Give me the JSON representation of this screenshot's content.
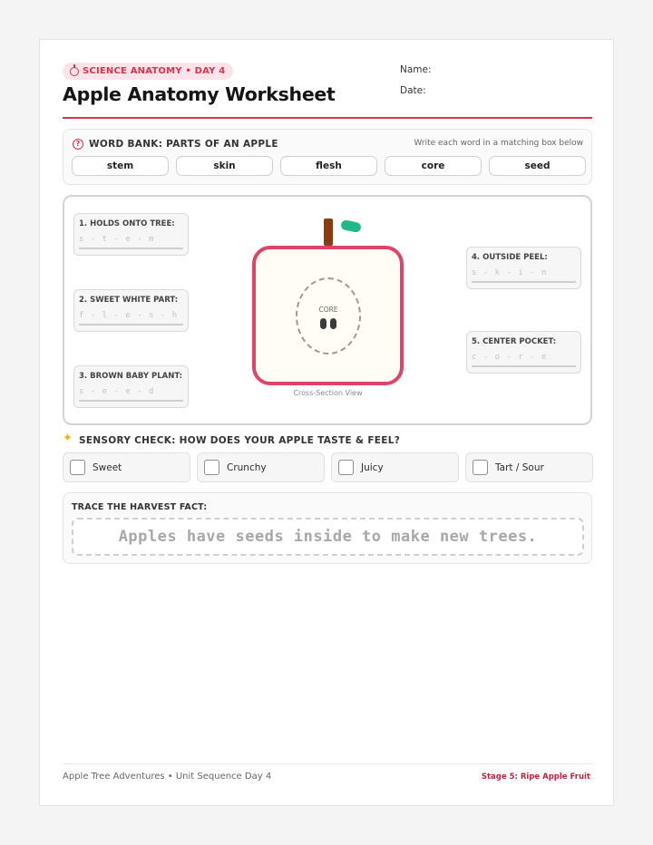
{
  "header": {
    "badge_text": "SCIENCE ANATOMY • DAY 4",
    "badge_icon": "apple-icon",
    "title": "Apple Anatomy Worksheet",
    "name_label": "Name:",
    "date_label": "Date:"
  },
  "word_bank": {
    "heading": "WORD BANK: PARTS OF AN APPLE",
    "hint": "Write each word in a matching box below",
    "words": [
      "stem",
      "skin",
      "flesh",
      "core",
      "seed"
    ]
  },
  "diagram": {
    "labels": [
      {
        "text": "1. HOLDS ONTO TREE:",
        "trace": "s - t - e - m"
      },
      {
        "text": "2. SWEET WHITE PART:",
        "trace": "f - l - e - s - h"
      },
      {
        "text": "3. BROWN BABY PLANT:",
        "trace": "s - e - e - d"
      },
      {
        "text": "4. OUTSIDE PEEL:",
        "trace": "s - k - i - n"
      },
      {
        "text": "5. CENTER POCKET:",
        "trace": "c - o - r - e"
      }
    ],
    "core_label": "CORE",
    "caption": "Cross-Section View"
  },
  "sensory": {
    "heading": "SENSORY CHECK: HOW DOES YOUR APPLE TASTE & FEEL?",
    "options": [
      "Sweet",
      "Crunchy",
      "Juicy",
      "Tart / Sour"
    ]
  },
  "trace_fact": {
    "heading": "TRACE THE HARVEST FACT:",
    "text": "Apples have seeds inside to make new trees."
  },
  "footer": {
    "left": "Apple Tree Adventures • Unit Sequence Day 4",
    "right": "Stage 5: Ripe Apple Fruit"
  },
  "colors": {
    "accent": "#d8334f",
    "apple_outline": "#df4468",
    "stem": "#8a3b10",
    "leaf": "#22b98a"
  }
}
